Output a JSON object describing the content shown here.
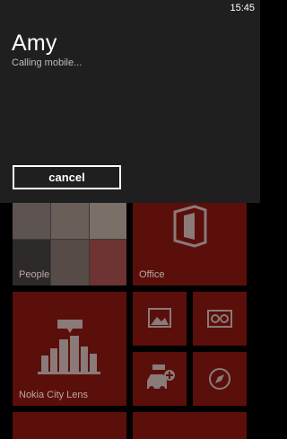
{
  "status_bar": {
    "time": "15:45"
  },
  "call": {
    "contact_name": "Amy",
    "status_text": "Calling mobile...",
    "cancel_label": "cancel"
  },
  "tiles": {
    "people_label": "People",
    "office_label": "Office",
    "city_lens_label": "Nokia City Lens"
  },
  "colors": {
    "accent": "#e51400",
    "overlay": "#1f1f1f"
  }
}
